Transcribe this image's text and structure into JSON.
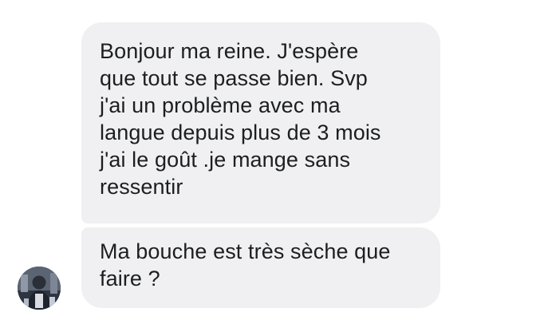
{
  "conversation": {
    "messages": [
      {
        "text": "Bonjour ma reine. J'espère\nque tout se passe bien. Svp\nj'ai un problème avec ma\nlangue depuis plus de 3 mois\nj'ai le goût .je mange sans\nressentir"
      },
      {
        "text": "Ma bouche est très sèche que\nfaire ?"
      }
    ],
    "sender": {
      "avatar_icon": "profile-photo"
    }
  },
  "colors": {
    "bubble_background": "#f0f0f2",
    "text": "#1c1e21",
    "page_background": "#ffffff"
  }
}
